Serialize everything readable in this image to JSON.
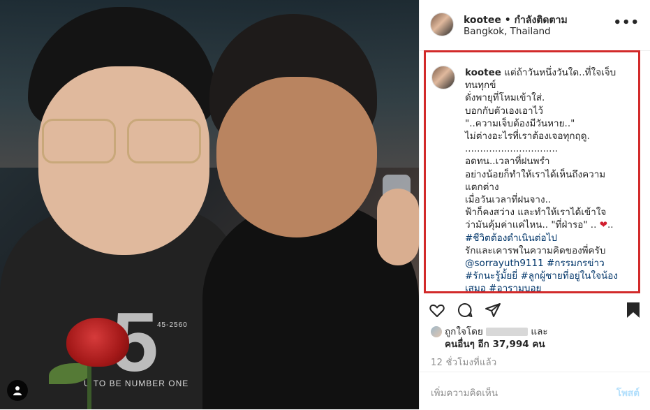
{
  "header": {
    "username": "kootee",
    "separator": "•",
    "follow_label": "กำลังติดตาม",
    "location": "Bangkok, Thailand",
    "more_icon": "more-options-icon"
  },
  "photo": {
    "shirt_number": "5",
    "shirt_small_text_top": "45-2560",
    "shirt_small_text": "U TO BE NUMBER ONE"
  },
  "caption": {
    "author": "kootee",
    "lines": [
      "แต่ถ้าวันหนึ่งวันใด..ที่ใจเจ็บ",
      "ทนทุกข์",
      "ดั่งพายุที่โหมเข้าใส่.",
      "บอกกับตัวเองเอาไว้",
      "\"..ความเจ็บต้องมีวันหาย..\"",
      "ไม่ต่างอะไรที่เราต้องเจอทุกฤดู.",
      "...............................",
      "อดทน..เวลาที่ฝนพรำ",
      "อย่างน้อยก็ทำให้เราได้เห็นถึงความ",
      "แตกต่าง",
      "เมื่อวันเวลาที่ฝนจาง..",
      "ฟ้าก็คงสว่าง และทำให้เราได้เข้าใจ",
      "ว่ามันคุ้มค่าแค่ไหน.. \"ที่ฝ่ารอ\" ..",
      "#ชีวิตต้องดำเนินต่อไป",
      "รักและเคารพในความคิดของพี่ครับ",
      "@sorrayuth9111 #กรรมกรข่าว",
      "#รักนะรู้มั้ยยี่ #ลูกผู้ชายที่อยู่ในใจน้อง",
      "เสมอ #อารามบอย"
    ],
    "heart_suffix": ".."
  },
  "actions": {
    "like_icon": "heart-icon",
    "comment_icon": "comment-icon",
    "share_icon": "share-icon",
    "save_icon": "bookmark-icon"
  },
  "likes": {
    "prefix": "ถูกใจโดย",
    "and": "และ",
    "others": "คนอื่นๆ อีก 37,994 คน"
  },
  "time": "12 ชั่วโมงที่แล้ว",
  "comment": {
    "placeholder": "เพิ่มความคิดเห็น",
    "post_label": "โพสต์"
  },
  "colors": {
    "highlight_border": "#d22a2a",
    "hashtag": "#003569",
    "heart": "#d11f2f",
    "post_button": "#b2dffc"
  }
}
